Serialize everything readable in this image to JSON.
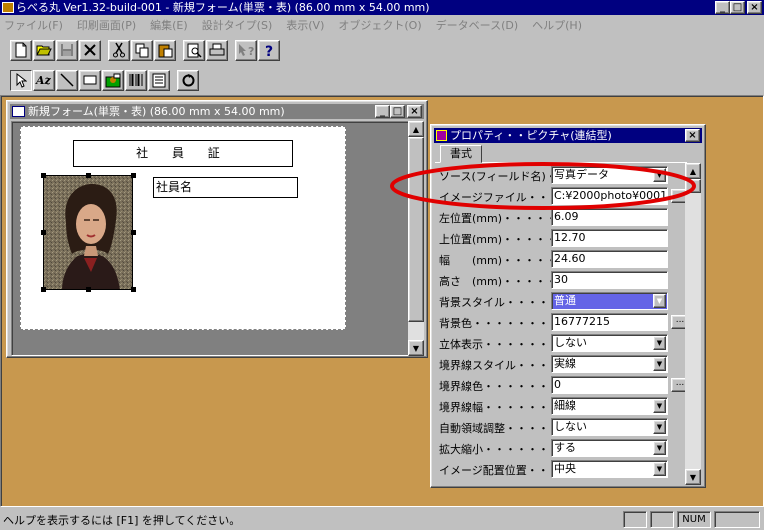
{
  "window": {
    "title": "らべる丸 Ver1.32-build-001 - 新規フォーム(単票・表) (86.00 mm x 54.00 mm)",
    "min": "_",
    "max": "□",
    "close": "×"
  },
  "menu": [
    "ファイル(F)",
    "印刷画面(P)",
    "編集(E)",
    "設計タイプ(S)",
    "表示(V)",
    "オブジェクト(O)",
    "データベース(D)",
    "ヘルプ(H)"
  ],
  "toolbar1": [
    "new-icon",
    "open-icon",
    "save-icon",
    "delete-icon",
    "cut-icon",
    "copy-icon",
    "paste-icon",
    "print-preview-icon",
    "print-icon",
    "context-help-icon",
    "help-icon"
  ],
  "toolbar2": [
    "pointer-icon",
    "text-icon",
    "line-icon",
    "rectangle-icon",
    "picture-icon",
    "barcode-icon",
    "list-icon",
    "refresh-icon"
  ],
  "child_window": {
    "title": "新規フォーム(単票・表) (86.00 mm x 54.00 mm)",
    "card_title": "社 員 証",
    "name_field": "社員名"
  },
  "property_window": {
    "title": "プロパティ・・ピクチャ(連結型)",
    "tab": "書式",
    "rows": [
      {
        "label": "ソース(フィールド名)・・・・",
        "value": "写真データ"
      },
      {
        "label": "イメージファイル・・・・・・・",
        "value": "C:¥2000photo¥0001."
      },
      {
        "label": "左位置(mm)・・・・・・・",
        "value": "6.09"
      },
      {
        "label": "上位置(mm)・・・・・・・",
        "value": "12.70"
      },
      {
        "label": "幅　　(mm)・・・・・・・",
        "value": "24.60"
      },
      {
        "label": "高さ　(mm)・・・・・・・",
        "value": "30"
      },
      {
        "label": "背景スタイル・・・・・・・・",
        "value": "普通"
      },
      {
        "label": "背景色・・・・・・・・・・",
        "value": "16777215"
      },
      {
        "label": "立体表示・・・・・・・・・",
        "value": "しない"
      },
      {
        "label": "境界線スタイル・・・・・・",
        "value": "実線"
      },
      {
        "label": "境界線色・・・・・・・・・",
        "value": "0"
      },
      {
        "label": "境界線幅・・・・・・・・・",
        "value": "細線"
      },
      {
        "label": "自動領域調整・・・・・・",
        "value": "しない"
      },
      {
        "label": "拡大縮小・・・・・・・・・",
        "value": "する"
      },
      {
        "label": "イメージ配置位置・・・・",
        "value": "中央"
      }
    ],
    "dots": "..."
  },
  "status": {
    "text": "ヘルプを表示するには [F1] を押してください。",
    "num": "NUM"
  },
  "colors": {
    "mdi_background": "#c8984e",
    "active_title": "#000080",
    "annotation": "#e00000"
  }
}
